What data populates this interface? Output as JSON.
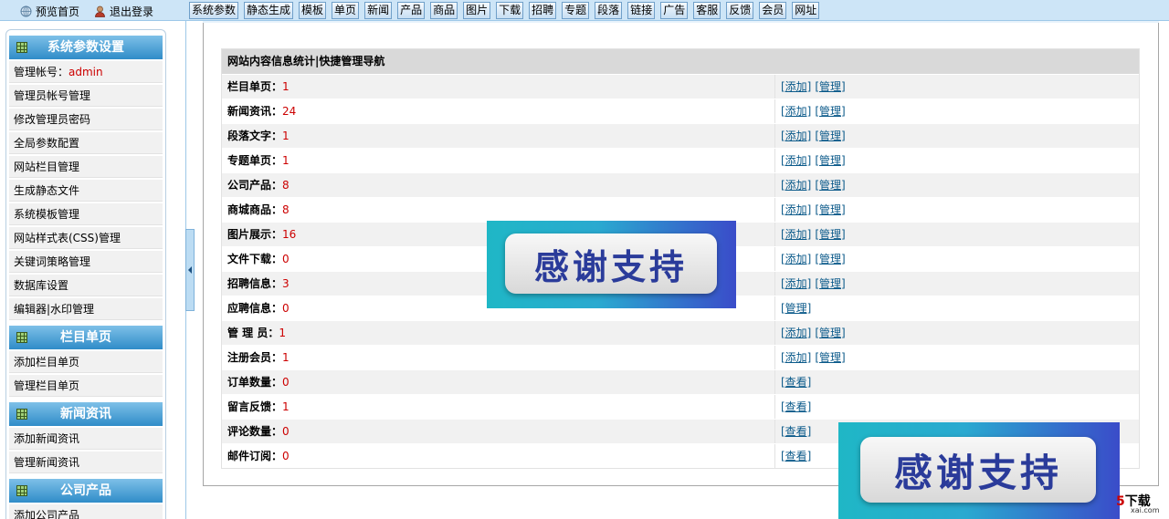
{
  "topbar": {
    "home_label": "预览首页",
    "logout_label": "退出登录",
    "nav": [
      "系统参数",
      "静态生成",
      "模板",
      "单页",
      "新闻",
      "产品",
      "商品",
      "图片",
      "下载",
      "招聘",
      "专题",
      "段落",
      "链接",
      "广告",
      "客服",
      "反馈",
      "会员",
      "网址"
    ]
  },
  "sidebar": {
    "sections": [
      {
        "title": "系统参数设置",
        "items": [
          "管理帐号：",
          "管理员帐号管理",
          "修改管理员密码",
          "全局参数配置",
          "网站栏目管理",
          "生成静态文件",
          "系统模板管理",
          "网站样式表(CSS)管理",
          "关键词策略管理",
          "数据库设置",
          "编辑器|水印管理"
        ]
      },
      {
        "title": "栏目单页",
        "items": [
          "添加栏目单页",
          "管理栏目单页"
        ]
      },
      {
        "title": "新闻资讯",
        "items": [
          "添加新闻资讯",
          "管理新闻资讯"
        ]
      },
      {
        "title": "公司产品",
        "items": [
          "添加公司产品"
        ]
      }
    ],
    "admin_name": "admin"
  },
  "main": {
    "table_title": "网站内容信息统计|快捷管理导航",
    "rows": [
      {
        "label": "栏目单页：",
        "value": "1",
        "ops": [
          "[添加]",
          "[管理]"
        ]
      },
      {
        "label": "新闻资讯：",
        "value": "24",
        "ops": [
          "[添加]",
          "[管理]"
        ]
      },
      {
        "label": "段落文字：",
        "value": "1",
        "ops": [
          "[添加]",
          "[管理]"
        ]
      },
      {
        "label": "专题单页：",
        "value": "1",
        "ops": [
          "[添加]",
          "[管理]"
        ]
      },
      {
        "label": "公司产品：",
        "value": "8",
        "ops": [
          "[添加]",
          "[管理]"
        ]
      },
      {
        "label": "商城商品：",
        "value": "8",
        "ops": [
          "[添加]",
          "[管理]"
        ]
      },
      {
        "label": "图片展示：",
        "value": "16",
        "ops": [
          "[添加]",
          "[管理]"
        ]
      },
      {
        "label": "文件下载：",
        "value": "0",
        "ops": [
          "[添加]",
          "[管理]"
        ]
      },
      {
        "label": "招聘信息：",
        "value": "3",
        "ops": [
          "[添加]",
          "[管理]"
        ]
      },
      {
        "label": "应聘信息：",
        "value": "0",
        "ops": [
          "[管理]"
        ]
      },
      {
        "label": "管 理 员：",
        "value": "1",
        "ops": [
          "[添加]",
          "[管理]"
        ]
      },
      {
        "label": "注册会员：",
        "value": "1",
        "ops": [
          "[添加]",
          "[管理]"
        ]
      },
      {
        "label": "订单数量：",
        "value": "0",
        "ops": [
          "[查看]"
        ]
      },
      {
        "label": "留言反馈：",
        "value": "1",
        "ops": [
          "[查看]"
        ]
      },
      {
        "label": "评论数量：",
        "value": "0",
        "ops": [
          "[查看]"
        ]
      },
      {
        "label": "邮件订阅：",
        "value": "0",
        "ops": [
          "[查看]"
        ]
      }
    ]
  },
  "overlays": {
    "thanks_text": "感谢支持"
  },
  "logo": {
    "mark": "5",
    "text": "下载",
    "sub": "xai.com"
  }
}
